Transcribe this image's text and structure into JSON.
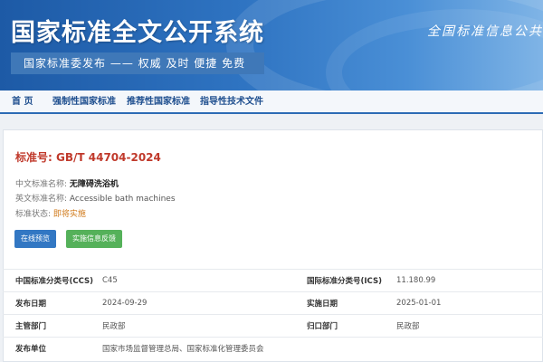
{
  "banner": {
    "title": "国家标准全文公开系统",
    "subtitle": "国家标准委发布 —— 权威 及时 便捷 免费",
    "right_slogan": "全国标准信息公共"
  },
  "nav": {
    "items": [
      "首 页",
      "强制性国家标准",
      "推荐性国家标准",
      "指导性技术文件"
    ]
  },
  "standard": {
    "number_label": "标准号:",
    "number": "GB/T 44704-2024",
    "cn_name_label": "中文标准名称:",
    "cn_name": "无障碍洗浴机",
    "en_name_label": "英文标准名称:",
    "en_name": "Accessible bath machines",
    "status_label": "标准状态:",
    "status": "即将实施"
  },
  "buttons": {
    "preview": "在线预览",
    "feedback": "实施信息反馈"
  },
  "info": {
    "ccs_label": "中国标准分类号(CCS)",
    "ccs": "C45",
    "ics_label": "国际标准分类号(ICS)",
    "ics": "11.180.99",
    "publish_label": "发布日期",
    "publish": "2024-09-29",
    "effective_label": "实施日期",
    "effective": "2025-01-01",
    "dept_label": "主管部门",
    "dept": "民政部",
    "owner_label": "归口部门",
    "owner": "民政部",
    "issuer_label": "发布单位",
    "issuer": "国家市场监督管理总局、国家标准化管理委员会"
  },
  "colors": {
    "banner_blue": "#1d5aa6",
    "nav_text": "#1f4f8f",
    "standard_number": "#c0392b",
    "status": "#d07a1a",
    "preview_button": "#3277c3",
    "feedback_button": "#55b15a"
  }
}
